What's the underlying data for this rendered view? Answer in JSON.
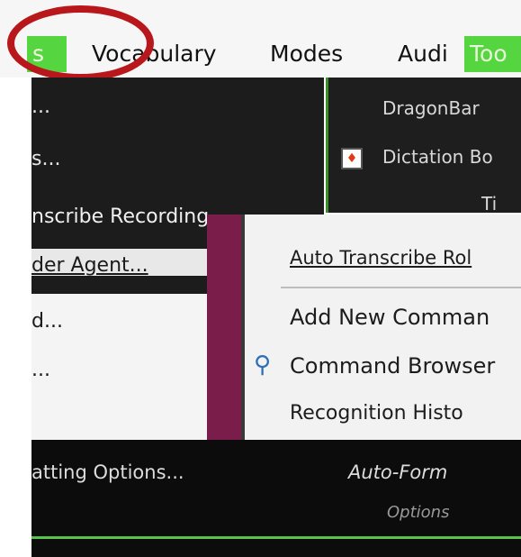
{
  "menubar": {
    "tools_left": "s",
    "vocabulary": "Vocabulary",
    "modes": "Modes",
    "audio": "Audi",
    "tools_right": "Too"
  },
  "left_menu": {
    "items": [
      "...",
      "s...",
      "nscribe Recording",
      "der Agent...",
      "d...",
      "..."
    ]
  },
  "dragon_panel": {
    "items": [
      "DragonBar",
      "Dictation Bo"
    ],
    "third": "Ti"
  },
  "sub_menu": {
    "items": [
      "Auto Transcribe Rol",
      "Add New Comman",
      "Command Browser",
      "Recognition Histo"
    ]
  },
  "bottom": {
    "left_text": "atting Options...",
    "right_text": "Auto-Form",
    "right_sub": "Options"
  },
  "colors": {
    "highlight": "#55d640",
    "annotation_circle": "#b8171c"
  }
}
